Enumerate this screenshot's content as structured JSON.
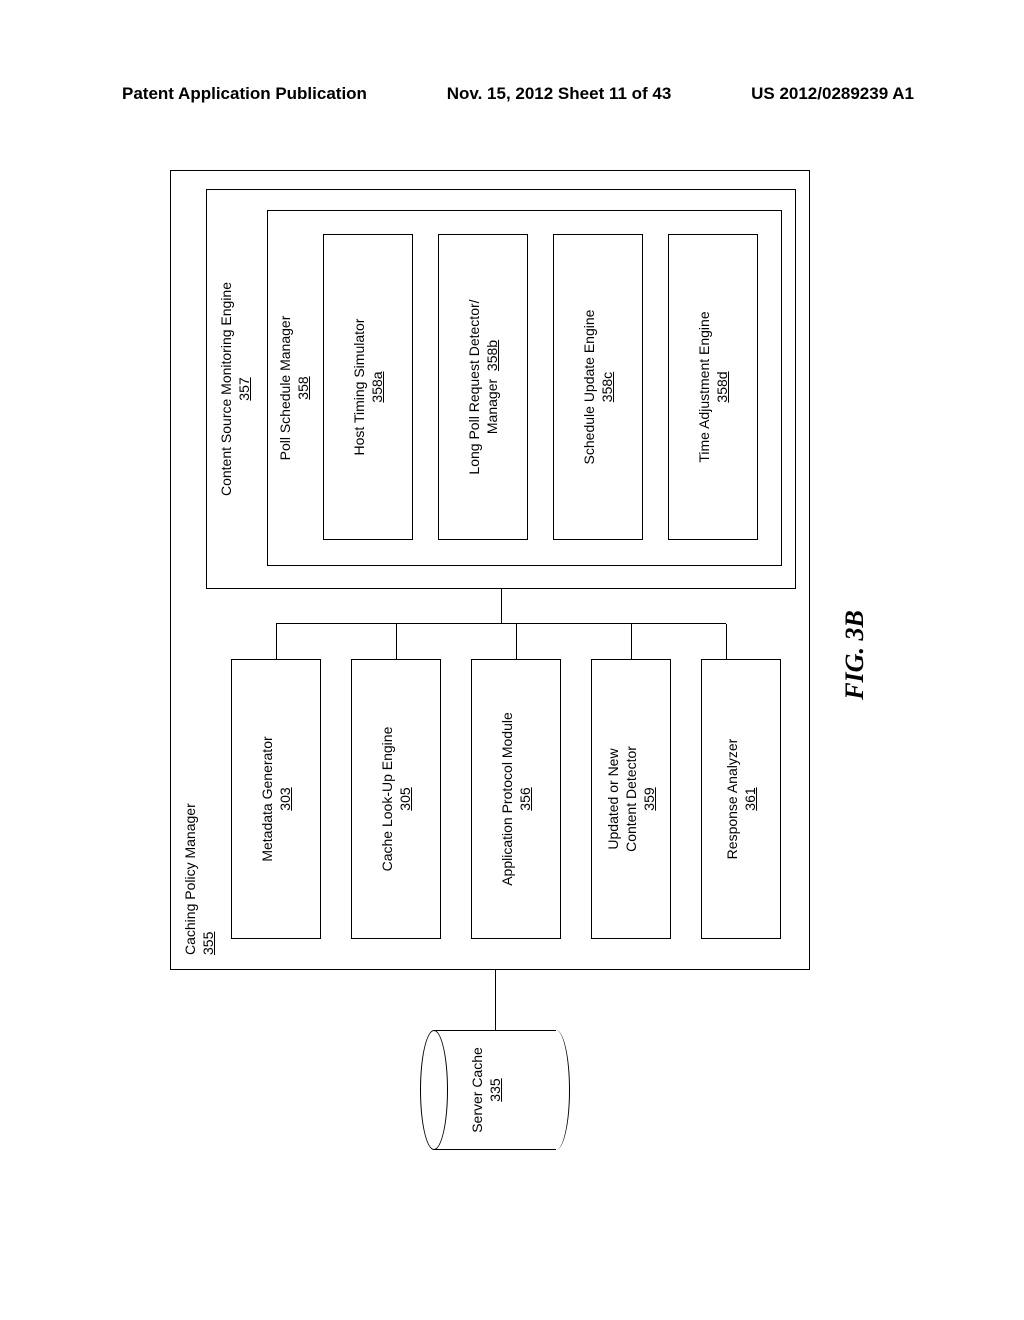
{
  "header": {
    "left": "Patent Application Publication",
    "center": "Nov. 15, 2012  Sheet 11 of 43",
    "right": "US 2012/0289239 A1"
  },
  "figure_label": "FIG. 3B",
  "server_cache": {
    "label": "Server Cache",
    "ref": "335"
  },
  "caching_policy_manager": {
    "label": "Caching Policy Manager",
    "ref": "355"
  },
  "left_modules": {
    "metadata_generator": {
      "label": "Metadata Generator",
      "ref": "303"
    },
    "cache_lookup": {
      "label": "Cache Look-Up Engine",
      "ref": "305"
    },
    "app_protocol": {
      "label": "Application Protocol Module",
      "ref": "356"
    },
    "content_detector": {
      "label": "Updated or New\nContent Detector",
      "ref": "359"
    },
    "response_analyzer": {
      "label": "Response Analyzer",
      "ref": "361"
    }
  },
  "content_source_monitoring": {
    "label": "Content Source Monitoring Engine",
    "ref": "357"
  },
  "poll_schedule_manager": {
    "label": "Poll Schedule Manager",
    "ref": "358"
  },
  "inner_modules": {
    "host_timing": {
      "label": "Host Timing Simulator",
      "ref": "358a"
    },
    "long_poll": {
      "label": "Long Poll Request Detector/\nManager",
      "ref": "358b"
    },
    "schedule_update": {
      "label": "Schedule Update Engine",
      "ref": "358c"
    },
    "time_adjust": {
      "label": "Time Adjustment Engine",
      "ref": "358d"
    }
  }
}
